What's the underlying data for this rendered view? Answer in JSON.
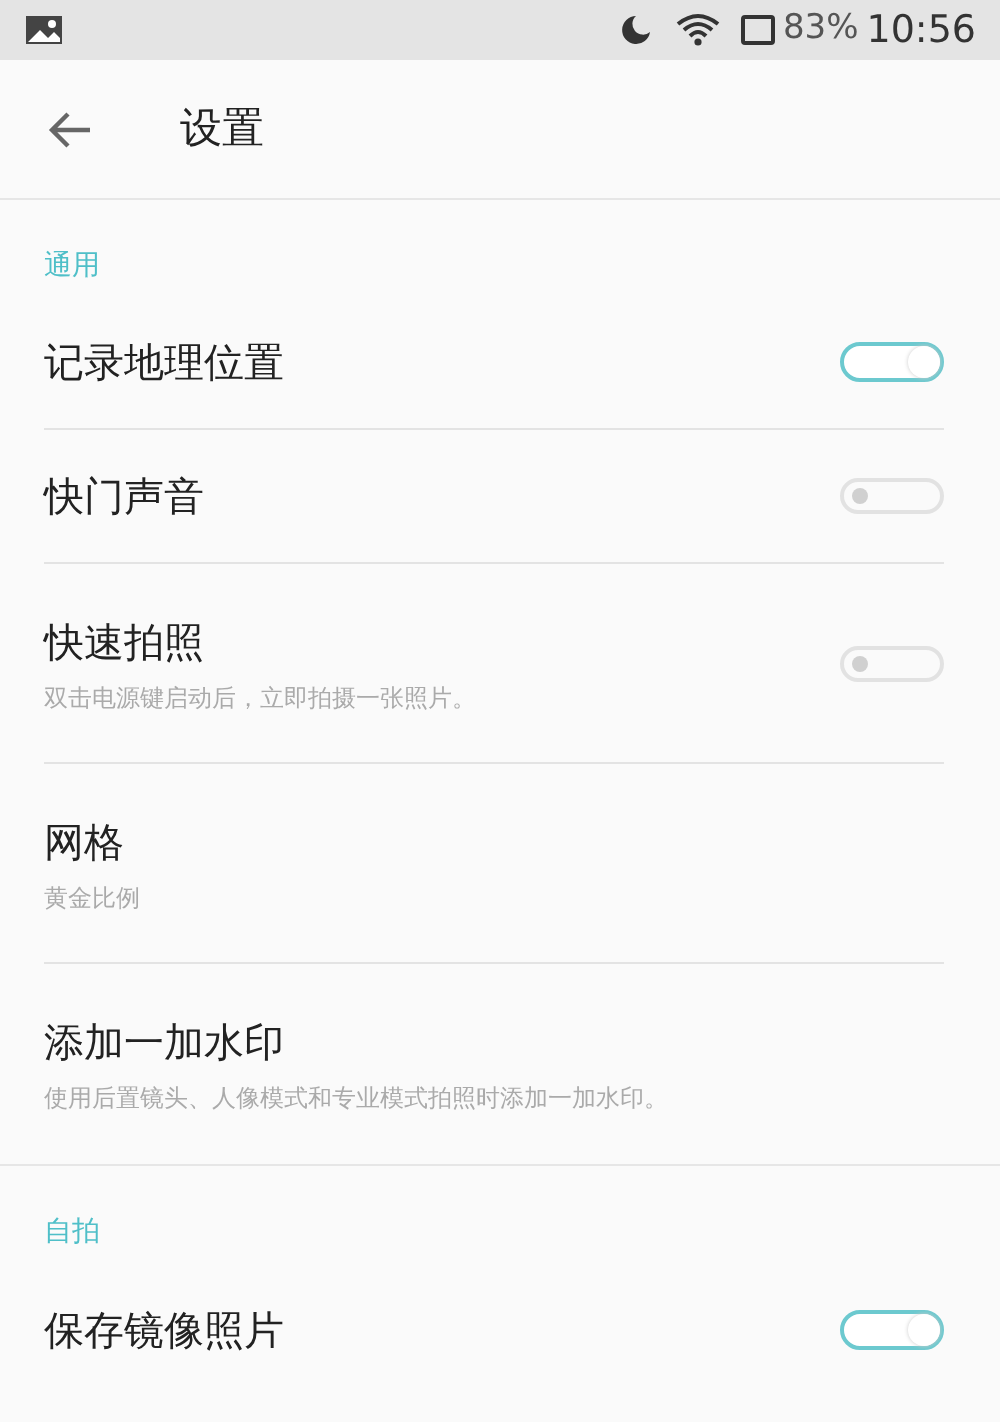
{
  "status_bar": {
    "battery": "83%",
    "time": "10:56"
  },
  "header": {
    "title": "设置"
  },
  "sections": [
    {
      "title": "通用",
      "items": [
        {
          "kind": "switch",
          "label": "记录地理位置",
          "on": true
        },
        {
          "kind": "switch",
          "label": "快门声音",
          "on": false
        },
        {
          "kind": "switch",
          "label": "快速拍照",
          "subtitle": "双击电源键启动后，立即拍摄一张照片。",
          "on": false
        },
        {
          "kind": "text",
          "label": "网格",
          "subtitle": "黄金比例"
        },
        {
          "kind": "text",
          "label": "添加一加水印",
          "subtitle": "使用后置镜头、人像模式和专业模式拍照时添加一加水印。"
        }
      ]
    },
    {
      "title": "自拍",
      "items": [
        {
          "kind": "switch",
          "label": "保存镜像照片",
          "on": true
        }
      ]
    }
  ]
}
